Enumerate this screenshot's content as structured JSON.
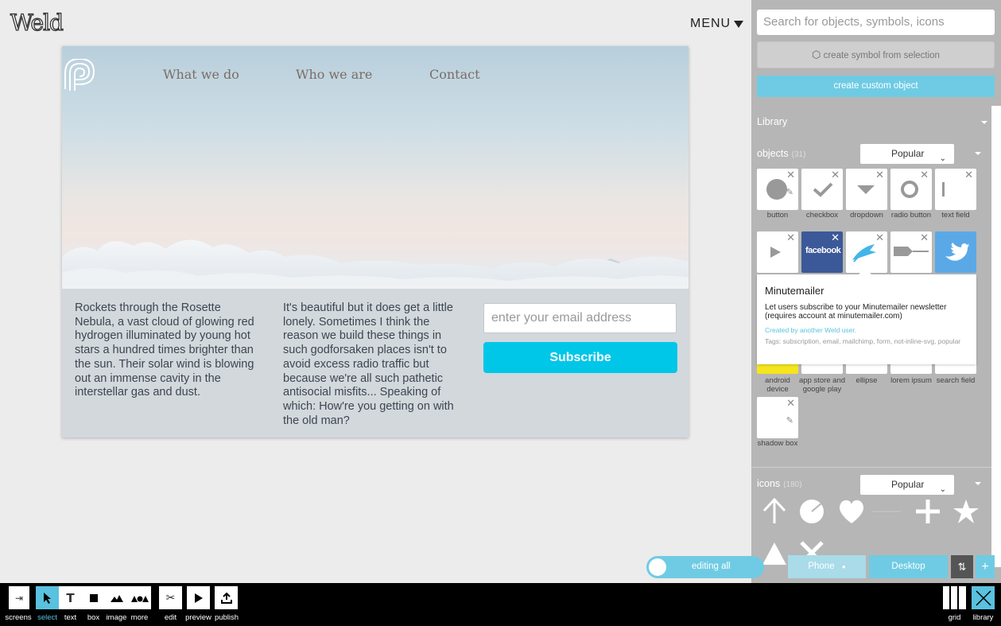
{
  "app": {
    "logo": "Weld",
    "menu_label": "MENU"
  },
  "site": {
    "nav": [
      "What we do",
      "Who we are",
      "Contact"
    ],
    "para1": "Rockets through the Rosette Nebula, a vast cloud of glowing red hydrogen illuminated by young hot stars a hundred times brighter than the sun. Their solar wind is blowing out an immense cavity in the interstellar gas and dust.",
    "para2": "It's beautiful but it does get a little lonely. Sometimes I think the reason we build these things in such godforsaken places isn't to avoid excess radio traffic but because we're all such pathetic antisocial misfits... Speaking of which: How're you getting on with the old man?",
    "email_placeholder": "enter your email address",
    "subscribe_label": "Subscribe"
  },
  "panel": {
    "search_placeholder": "Search for objects, symbols, icons",
    "create_symbol_label": "create symbol from selection",
    "create_custom_label": "create custom object",
    "library_label": "Library",
    "objects": {
      "label": "objects",
      "count": "(31)",
      "sort": "Popular"
    },
    "object_tiles_row1": [
      {
        "label": "button",
        "icon": "button-icon"
      },
      {
        "label": "checkbox",
        "icon": "checkbox-icon"
      },
      {
        "label": "dropdown",
        "icon": "dropdown-icon"
      },
      {
        "label": "radio button",
        "icon": "radio-button-icon"
      },
      {
        "label": "text field",
        "icon": "text-field-icon"
      }
    ],
    "object_tiles_row2": [
      {
        "icon": "video-play-icon"
      },
      {
        "icon": "facebook-icon",
        "text": "facebook"
      },
      {
        "icon": "minutemailer-icon"
      },
      {
        "icon": "slider-icon"
      },
      {
        "icon": "twitter-icon"
      }
    ],
    "object_tiles_row3_labels": [
      "android device",
      "app store and google play",
      "ellipse",
      "lorem ipsum",
      "search field"
    ],
    "object_tiles_row4_labels": [
      "shadow box"
    ],
    "tooltip": {
      "title": "Minutemailer",
      "description": "Let users subscribe to your Minutemailer newsletter (requires account at minutemailer.com)",
      "created_by": "Created by another Weld user.",
      "tags": "Tags: subscription, email, mailchimp, form, not-inline-svg, popular"
    },
    "icons": {
      "label": "icons",
      "count": "(180)",
      "sort": "Popular"
    },
    "icon_names": [
      "arrow-up-icon",
      "circle-arrow-icon",
      "heart-icon",
      "line-icon",
      "plus-icon",
      "star-icon",
      "triangle-icon",
      "x-mark-icon"
    ]
  },
  "devices": {
    "editing_label": "editing all",
    "phone": "Phone",
    "desktop": "Desktop"
  },
  "toolbar": {
    "screens": "screens",
    "select": "select",
    "text": "text",
    "box": "box",
    "image": "image",
    "more": "more",
    "edit": "edit",
    "preview": "preview",
    "publish": "publish",
    "grid": "grid",
    "library": "library"
  },
  "colors": {
    "accent": "#00c6e8",
    "panel_accent": "#6fcbe4",
    "panel_bg": "#b6b6b6"
  }
}
